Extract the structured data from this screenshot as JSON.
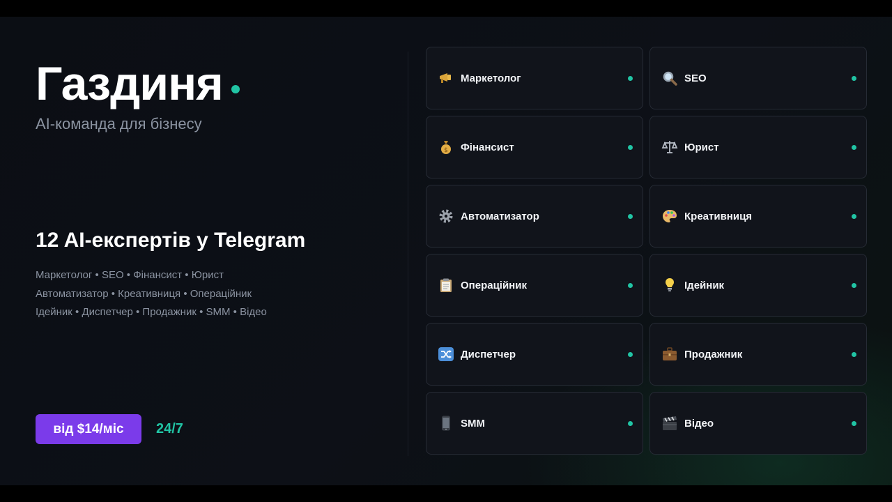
{
  "brand": {
    "title": "Газдиня",
    "subtitle": "AI-команда для бізнесу"
  },
  "heading": "12 AI-експертів у Telegram",
  "roles_lines": [
    "Маркетолог • SEO • Фінансист • Юрист",
    "Автоматизатор • Креативниця • Операційник",
    "Ідейник • Диспетчер • Продажник • SMM • Відео"
  ],
  "cta": {
    "price_label": "від $14/міс",
    "uptime_label": "24/7"
  },
  "colors": {
    "accent_teal": "#21c4a4",
    "button_purple": "#7b3bea",
    "background": "#0d1017",
    "card_bg": "#11141b"
  },
  "experts": [
    {
      "label": "Маркетолог",
      "icon": "megaphone-icon"
    },
    {
      "label": "SEO",
      "icon": "magnifier-icon"
    },
    {
      "label": "Фінансист",
      "icon": "money-bag-icon"
    },
    {
      "label": "Юрист",
      "icon": "scales-icon"
    },
    {
      "label": "Автоматизатор",
      "icon": "gear-icon"
    },
    {
      "label": "Креативниця",
      "icon": "palette-icon"
    },
    {
      "label": "Операційник",
      "icon": "clipboard-icon"
    },
    {
      "label": "Ідейник",
      "icon": "lightbulb-icon"
    },
    {
      "label": "Диспетчер",
      "icon": "shuffle-icon"
    },
    {
      "label": "Продажник",
      "icon": "briefcase-icon"
    },
    {
      "label": "SMM",
      "icon": "phone-icon"
    },
    {
      "label": "Відео",
      "icon": "clapperboard-icon"
    }
  ]
}
